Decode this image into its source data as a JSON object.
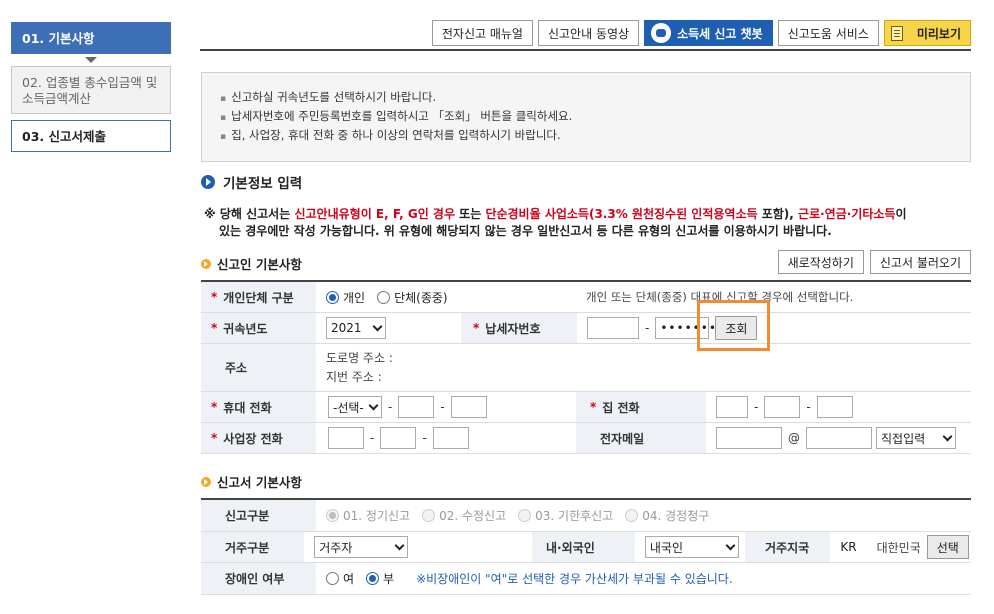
{
  "steps": [
    {
      "label": "01. 기본사항"
    },
    {
      "label": "02. 업종별 총수입금액 및 소득금액계산"
    },
    {
      "label": "03. 신고서제출"
    }
  ],
  "toolbar": {
    "manual": "전자신고 매뉴얼",
    "video": "신고안내 동영상",
    "chatbot": "소득세 신고 챗봇",
    "help": "신고도움 서비스",
    "preview": "미리보기"
  },
  "notice": [
    "신고하실 귀속년도를 선택하시기 바랍니다.",
    "납세자번호에 주민등록번호를 입력하시고 「조회」 버튼을 클릭하세요.",
    "집, 사업장, 휴대 전화 중 하나 이상의 연락처를 입력하시기 바랍니다."
  ],
  "section_title": "기본정보 입력",
  "warning": {
    "p1": "※ 당해 신고서는 ",
    "r1": "신고안내유형이 E, F, G인 경우",
    "p2": " 또는 ",
    "r2": "단순경비율 사업소득(3.3% 원천징수된 인적용역소득",
    "p3": " 포함), ",
    "r3": "근로·연금·기타소득",
    "p4": "이",
    "line2": "있는 경우에만 작성 가능합니다. 위 유형에 해당되지 않는 경우 일반신고서 등 다른 유형의 신고서를 이용하시기 바랍니다."
  },
  "reporter": {
    "title": "신고인 기본사항",
    "new_btn": "새로작성하기",
    "load_btn": "신고서 불러오기",
    "type_label": "개인단체 구분",
    "type_personal": "개인",
    "type_group": "단체(종중)",
    "type_hint": "개인 또는 단체(종중) 대표에 신고할 경우에 선택합니다.",
    "year_label": "귀속년도",
    "year_value": "2021",
    "taxid_label": "납세자번호",
    "taxid_masked": "•••••••",
    "lookup_btn": "조회",
    "addr_label": "주소",
    "addr_road": "도로명 주소 :",
    "addr_lot": "지번 주소 :",
    "mobile_label": "휴대 전화",
    "mobile_select": "-선택-",
    "home_label": "집 전화",
    "biz_label": "사업장 전화",
    "email_label": "전자메일",
    "email_at": "@",
    "email_domain": "직접입력"
  },
  "report": {
    "title": "신고서 기본사항",
    "kind_label": "신고구분",
    "kinds": [
      "01. 정기신고",
      "02. 수정신고",
      "03. 기한후신고",
      "04. 경정청구"
    ],
    "resident_label": "거주구분",
    "resident_value": "거주자",
    "nation_label": "내·외국인",
    "nation_value": "내국인",
    "region_label": "거주지국",
    "region_code": "KR",
    "region_name": "대한민국",
    "region_btn": "선택",
    "disabled_label": "장애인 여부",
    "disabled_yes": "여",
    "disabled_no": "부",
    "disabled_note": "※비장애인이 \"여\"로 선택한 경우 가산세가 부과될 수 있습니다."
  }
}
